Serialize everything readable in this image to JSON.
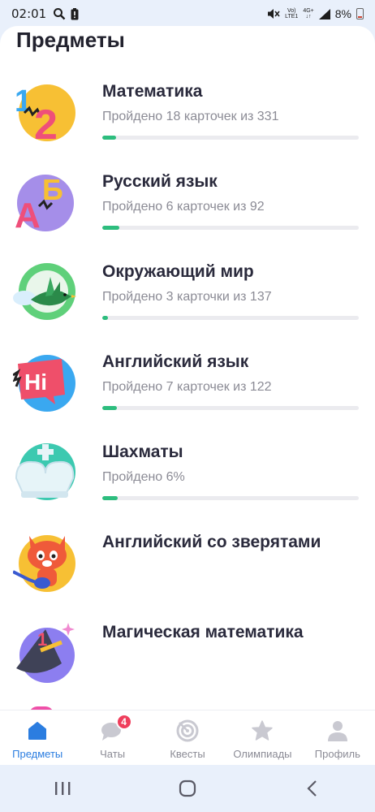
{
  "status_bar": {
    "time": "02:01",
    "signal_top": "Vo)",
    "signal_bottom": "LTE1",
    "network_top": "4G+",
    "network_bottom": "",
    "battery": "8%"
  },
  "page": {
    "title": "Предметы"
  },
  "subjects": [
    {
      "name": "Математика",
      "progress_text": "Пройдено 18 карточек из 331",
      "progress": 0.054,
      "icon": "numbers-12-icon"
    },
    {
      "name": "Русский язык",
      "progress_text": "Пройдено 6 карточек из 92",
      "progress": 0.065,
      "icon": "letters-ab-icon"
    },
    {
      "name": "Окружающий мир",
      "progress_text": "Пройдено 3 карточки из 137",
      "progress": 0.022,
      "icon": "bird-leaf-icon"
    },
    {
      "name": "Английский язык",
      "progress_text": "Пройдено 7 карточек из 122",
      "progress": 0.057,
      "icon": "hi-speech-bubble-icon"
    },
    {
      "name": "Шахматы",
      "progress_text": "Пройдено 6%",
      "progress": 0.06,
      "icon": "chess-king-icon"
    },
    {
      "name": "Английский со зверятами",
      "progress_text": "",
      "progress": null,
      "icon": "fox-guitar-icon"
    },
    {
      "name": "Магическая математика",
      "progress_text": "",
      "progress": null,
      "icon": "magic-hat-icon"
    }
  ],
  "bottom_nav": {
    "items": [
      {
        "label": "Предметы",
        "icon": "home-icon",
        "active": true
      },
      {
        "label": "Чаты",
        "icon": "chat-icon",
        "badge": "4"
      },
      {
        "label": "Квесты",
        "icon": "target-icon"
      },
      {
        "label": "Олимпиады",
        "icon": "star-icon"
      },
      {
        "label": "Профиль",
        "icon": "person-icon"
      }
    ]
  },
  "colors": {
    "accent": "#2b7de0",
    "progress": "#2dbd7e",
    "badge": "#ef3e5c",
    "muted_text": "#8b8b95"
  }
}
